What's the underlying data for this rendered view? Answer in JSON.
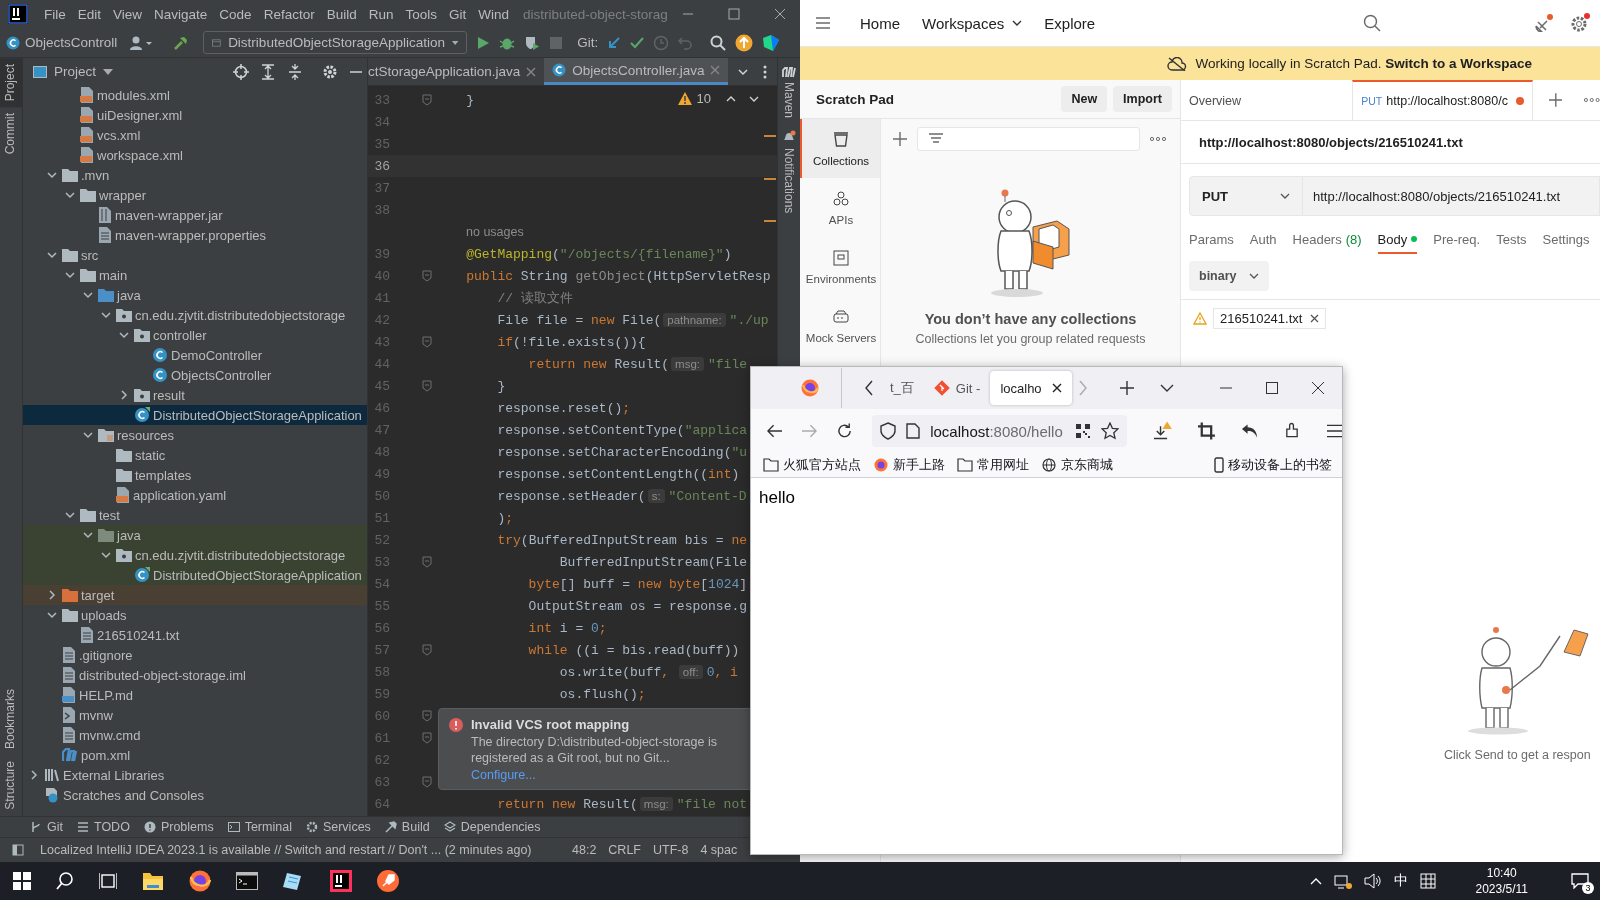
{
  "ide": {
    "menu": [
      "File",
      "Edit",
      "View",
      "Navigate",
      "Code",
      "Refactor",
      "Build",
      "Run",
      "Tools",
      "Git",
      "Wind"
    ],
    "title": "distributed-object-storag",
    "toolbar": {
      "file_label": "ObjectsControll",
      "run_config": "DistributedObjectStorageApplication",
      "vcs_label": "Git:"
    },
    "left_strip_top": [
      {
        "label": "Project",
        "selected": true
      },
      {
        "label": "Commit",
        "selected": false
      }
    ],
    "left_strip_bottom": [
      {
        "label": "Bookmarks",
        "selected": false
      },
      {
        "label": "Structure",
        "selected": false
      }
    ],
    "right_strip": [
      {
        "label": "Maven",
        "kind": "maven"
      },
      {
        "label": "Notifications",
        "kind": "bell"
      }
    ],
    "project_header": "Project",
    "tree": {
      "partial_top": [
        {
          "label": "modules.xml",
          "kind": "xml",
          "selected": false
        },
        {
          "label": "uiDesigner.xml",
          "kind": "xml",
          "selected": false
        },
        {
          "label": "vcs.xml",
          "kind": "xml",
          "selected": false
        },
        {
          "label": "workspace.xml",
          "kind": "xml",
          "selected": false
        }
      ],
      "items": [
        {
          "label": ".mvn",
          "kind": "folder",
          "expanded": true,
          "selected": false,
          "children": [
            {
              "label": "wrapper",
              "kind": "folder",
              "expanded": true,
              "selected": false,
              "children": [
                {
                  "label": "maven-wrapper.jar",
                  "kind": "jar",
                  "selected": false
                },
                {
                  "label": "maven-wrapper.properties",
                  "kind": "properties",
                  "selected": false
                }
              ]
            }
          ]
        },
        {
          "label": "src",
          "kind": "folder",
          "expanded": true,
          "selected": false,
          "children": [
            {
              "label": "main",
              "kind": "folder",
              "expanded": true,
              "selected": false,
              "children": [
                {
                  "label": "java",
                  "kind": "source-folder",
                  "expanded": true,
                  "selected": false,
                  "children": [
                    {
                      "label": "cn.edu.zjvtit.distributedobjectstorage",
                      "kind": "package",
                      "expanded": true,
                      "selected": false,
                      "children": [
                        {
                          "label": "controller",
                          "kind": "package",
                          "expanded": true,
                          "selected": false,
                          "children": [
                            {
                              "label": "DemoController",
                              "kind": "class",
                              "selected": false
                            },
                            {
                              "label": "ObjectsController",
                              "kind": "class",
                              "selected": false
                            }
                          ]
                        },
                        {
                          "label": "result",
                          "kind": "package",
                          "expanded": false,
                          "selected": false
                        },
                        {
                          "label": "DistributedObjectStorageApplication",
                          "kind": "spring-class",
                          "selected": true
                        }
                      ]
                    }
                  ]
                },
                {
                  "label": "resources",
                  "kind": "resources-folder",
                  "expanded": true,
                  "selected": false,
                  "children": [
                    {
                      "label": "static",
                      "kind": "folder",
                      "selected": false
                    },
                    {
                      "label": "templates",
                      "kind": "folder",
                      "selected": false
                    },
                    {
                      "label": "application.yaml",
                      "kind": "yaml",
                      "selected": false
                    }
                  ]
                }
              ]
            },
            {
              "label": "test",
              "kind": "folder",
              "expanded": true,
              "selected": false,
              "children": [
                {
                  "label": "java",
                  "kind": "test-folder",
                  "expanded": true,
                  "selected": false,
                  "test_scope": true,
                  "children": [
                    {
                      "label": "cn.edu.zjvtit.distributedobjectstorage",
                      "kind": "package",
                      "expanded": true,
                      "selected": false,
                      "test_scope": true,
                      "children": [
                        {
                          "label": "DistributedObjectStorageApplication",
                          "kind": "spring-class",
                          "selected": false,
                          "test_scope": true
                        }
                      ]
                    }
                  ]
                }
              ]
            }
          ]
        },
        {
          "label": "target",
          "kind": "excluded-folder",
          "expanded": false,
          "selected": false,
          "excluded": true
        },
        {
          "label": "uploads",
          "kind": "folder",
          "expanded": true,
          "selected": false,
          "children": [
            {
              "label": "216510241.txt",
              "kind": "text",
              "selected": false
            }
          ]
        },
        {
          "label": ".gitignore",
          "kind": "gitignore",
          "selected": false
        },
        {
          "label": "distributed-object-storage.iml",
          "kind": "iml",
          "selected": false
        },
        {
          "label": "HELP.md",
          "kind": "markdown",
          "selected": false
        },
        {
          "label": "mvnw",
          "kind": "script",
          "selected": false
        },
        {
          "label": "mvnw.cmd",
          "kind": "text",
          "selected": false
        },
        {
          "label": "pom.xml",
          "kind": "maven",
          "selected": false
        }
      ],
      "libraries": [
        {
          "label": "External Libraries",
          "kind": "libraries",
          "expanded": false,
          "selected": false
        },
        {
          "label": "Scratches and Consoles",
          "kind": "scratches",
          "selected": false
        }
      ]
    },
    "editor_tabs": [
      {
        "label": "ctStorageApplication.java",
        "selected": false
      },
      {
        "label": "ObjectsController.java",
        "selected": true
      }
    ],
    "warning_count": "10",
    "lines": [
      {
        "kind": "code",
        "number": "33",
        "current": false,
        "fold": true,
        "segments": [
          {
            "text": "    }",
            "kind": "plain"
          }
        ]
      },
      {
        "kind": "code",
        "number": "34",
        "current": false
      },
      {
        "kind": "code",
        "number": "35",
        "current": false
      },
      {
        "kind": "code",
        "number": "36",
        "current": true
      },
      {
        "kind": "code",
        "number": "37",
        "current": false
      },
      {
        "kind": "code",
        "number": "38",
        "current": false
      },
      {
        "kind": "inlay",
        "text": "no usages"
      },
      {
        "kind": "code",
        "number": "39",
        "current": false,
        "segments": [
          {
            "text": "    @GetMapping",
            "kind": "ann"
          },
          {
            "text": "(",
            "kind": "plain"
          },
          {
            "text": "\"/objects/{filename}\"",
            "kind": "str"
          },
          {
            "text": ")",
            "kind": "plain"
          }
        ]
      },
      {
        "kind": "code",
        "number": "40",
        "current": false,
        "fold": true,
        "segments": [
          {
            "text": "    public",
            "kind": "kw"
          },
          {
            "text": " String ",
            "kind": "plain"
          },
          {
            "text": "getObject",
            "kind": "fn"
          },
          {
            "text": "(HttpServletResp",
            "kind": "plain"
          }
        ]
      },
      {
        "kind": "code",
        "number": "41",
        "current": false,
        "segments": [
          {
            "text": "        // 读取文件",
            "kind": "cm"
          }
        ]
      },
      {
        "kind": "code",
        "number": "42",
        "current": false,
        "segments": [
          {
            "text": "        File file = ",
            "kind": "plain"
          },
          {
            "text": "new",
            "kind": "kw"
          },
          {
            "text": " File(",
            "kind": "plain"
          },
          {
            "text": "pathname:",
            "kind": "hint"
          },
          {
            "text": "\"./up",
            "kind": "str"
          }
        ]
      },
      {
        "kind": "code",
        "number": "43",
        "current": false,
        "fold": true,
        "segments": [
          {
            "text": "        if",
            "kind": "kw"
          },
          {
            "text": "(!file.exists()){",
            "kind": "plain"
          }
        ]
      },
      {
        "kind": "code",
        "number": "44",
        "current": false,
        "segments": [
          {
            "text": "            return new",
            "kind": "kw"
          },
          {
            "text": " Result(",
            "kind": "plain"
          },
          {
            "text": "msg:",
            "kind": "hint"
          },
          {
            "text": "\"file",
            "kind": "str"
          }
        ]
      },
      {
        "kind": "code",
        "number": "45",
        "current": false,
        "fold": true,
        "segments": [
          {
            "text": "        }",
            "kind": "plain"
          }
        ]
      },
      {
        "kind": "code",
        "number": "46",
        "current": false,
        "segments": [
          {
            "text": "        response.reset()",
            "kind": "plain"
          },
          {
            "text": ";",
            "kind": "kw"
          }
        ]
      },
      {
        "kind": "code",
        "number": "47",
        "current": false,
        "segments": [
          {
            "text": "        response.setContentType(",
            "kind": "plain"
          },
          {
            "text": "\"applica",
            "kind": "str"
          }
        ]
      },
      {
        "kind": "code",
        "number": "48",
        "current": false,
        "segments": [
          {
            "text": "        response.setCharacterEncoding(",
            "kind": "plain"
          },
          {
            "text": "\"u",
            "kind": "str"
          }
        ]
      },
      {
        "kind": "code",
        "number": "49",
        "current": false,
        "segments": [
          {
            "text": "        response.setContentLength((",
            "kind": "plain"
          },
          {
            "text": "int",
            "kind": "kw"
          },
          {
            "text": ")",
            "kind": "plain"
          }
        ]
      },
      {
        "kind": "code",
        "number": "50",
        "current": false,
        "segments": [
          {
            "text": "        response.setHeader(",
            "kind": "plain"
          },
          {
            "text": "s:",
            "kind": "hint"
          },
          {
            "text": "\"Content-D",
            "kind": "str"
          }
        ]
      },
      {
        "kind": "code",
        "number": "51",
        "current": false,
        "segments": [
          {
            "text": "        )",
            "kind": "plain"
          },
          {
            "text": ";",
            "kind": "kw"
          }
        ]
      },
      {
        "kind": "code",
        "number": "52",
        "current": false,
        "segments": [
          {
            "text": "        try",
            "kind": "kw"
          },
          {
            "text": "(BufferedInputStream bis = ",
            "kind": "plain"
          },
          {
            "text": "ne",
            "kind": "kw"
          }
        ]
      },
      {
        "kind": "code",
        "number": "53",
        "current": false,
        "fold": true,
        "segments": [
          {
            "text": "                BufferedInputStream(File",
            "kind": "plain"
          }
        ]
      },
      {
        "kind": "code",
        "number": "54",
        "current": false,
        "segments": [
          {
            "text": "            byte",
            "kind": "kw"
          },
          {
            "text": "[] buff = ",
            "kind": "plain"
          },
          {
            "text": "new byte",
            "kind": "kw"
          },
          {
            "text": "[",
            "kind": "plain"
          },
          {
            "text": "1024",
            "kind": "num"
          },
          {
            "text": "]",
            "kind": "plain"
          }
        ]
      },
      {
        "kind": "code",
        "number": "55",
        "current": false,
        "segments": [
          {
            "text": "            OutputStream os = response.g",
            "kind": "plain"
          }
        ]
      },
      {
        "kind": "code",
        "number": "56",
        "current": false,
        "segments": [
          {
            "text": "            int",
            "kind": "kw"
          },
          {
            "text": " i = ",
            "kind": "plain"
          },
          {
            "text": "0",
            "kind": "num"
          },
          {
            "text": ";",
            "kind": "kw"
          }
        ]
      },
      {
        "kind": "code",
        "number": "57",
        "current": false,
        "fold": true,
        "segments": [
          {
            "text": "            while",
            "kind": "kw"
          },
          {
            "text": " ((i = bis.read(buff))",
            "kind": "plain"
          }
        ]
      },
      {
        "kind": "code",
        "number": "58",
        "current": false,
        "segments": [
          {
            "text": "                os.write(buff",
            "kind": "plain"
          },
          {
            "text": ", ",
            "kind": "kw"
          },
          {
            "text": "off:",
            "kind": "hint"
          },
          {
            "text": "0",
            "kind": "num"
          },
          {
            "text": ", i",
            "kind": "kw"
          }
        ]
      },
      {
        "kind": "code",
        "number": "59",
        "current": false,
        "segments": [
          {
            "text": "                os.flush()",
            "kind": "plain"
          },
          {
            "text": ";",
            "kind": "kw"
          }
        ]
      },
      {
        "kind": "code",
        "number": "60",
        "current": false,
        "fold": true
      },
      {
        "kind": "code",
        "number": "61",
        "current": false,
        "fold": true
      },
      {
        "kind": "code",
        "number": "62",
        "current": false
      },
      {
        "kind": "code",
        "number": "63",
        "current": false,
        "fold": true
      },
      {
        "kind": "code",
        "number": "64",
        "current": false,
        "segments": [
          {
            "text": "        return new",
            "kind": "kw"
          },
          {
            "text": " Result(",
            "kind": "plain"
          },
          {
            "text": "msg:",
            "kind": "hint"
          },
          {
            "text": "\"file not",
            "kind": "str"
          }
        ]
      }
    ],
    "notification": {
      "title": "Invalid VCS root mapping",
      "body": "The directory D:\\distributed-object-storage is registered as a Git root, but no Git...",
      "link": "Configure..."
    },
    "tool_tabs": [
      {
        "label": "Git",
        "kind": "branch"
      },
      {
        "label": "TODO",
        "kind": "list"
      },
      {
        "label": "Problems",
        "kind": "alert"
      },
      {
        "label": "Terminal",
        "kind": "terminal"
      },
      {
        "label": "Services",
        "kind": "gear"
      },
      {
        "label": "Build",
        "kind": "hammer"
      },
      {
        "label": "Dependencies",
        "kind": "layers"
      }
    ],
    "status": {
      "message": "Localized IntelliJ IDEA 2023.1 is available // Switch and restart // Don't ... (2 minutes ago)",
      "position": "48:2",
      "line_ending": "CRLF",
      "encoding": "UTF-8",
      "indent": "4 spac"
    }
  },
  "postman": {
    "nav": [
      {
        "label": "Home",
        "kind": "link"
      },
      {
        "label": "Workspaces",
        "kind": "menu"
      },
      {
        "label": "Explore",
        "kind": "link"
      }
    ],
    "banner": "Working locally in Scratch Pad. **Switch to a Workspace**",
    "sidebar": {
      "title": "Scratch Pad",
      "buttons": [
        "New",
        "Import"
      ],
      "nav": [
        {
          "label": "Collections",
          "kind": "collections",
          "selected": true
        },
        {
          "label": "APIs",
          "kind": "apis",
          "selected": false
        },
        {
          "label": "Environments",
          "kind": "environments",
          "selected": false
        },
        {
          "label": "Mock Servers",
          "kind": "mock",
          "selected": false
        }
      ],
      "empty_title": "You don’t have any collections",
      "empty_text": "Collections let you group related requests"
    },
    "tabs": [
      {
        "kind": "overview",
        "label": "Overview",
        "selected": false
      },
      {
        "kind": "request",
        "method": "PUT",
        "label": "http://localhost:8080/c",
        "selected": true,
        "unsaved": true
      }
    ],
    "request": {
      "name": "http://localhost:8080/objects/216510241.txt",
      "method": "PUT",
      "url": "http://localhost:8080/objects/216510241.txt",
      "tabs": [
        {
          "label": "Params",
          "selected": false
        },
        {
          "label": "Auth",
          "selected": false
        },
        {
          "label": "Headers",
          "count": "(8)",
          "selected": false
        },
        {
          "label": "Body",
          "selected": true,
          "has_content": true
        },
        {
          "label": "Pre-req.",
          "selected": false
        },
        {
          "label": "Tests",
          "selected": false
        },
        {
          "label": "Settings",
          "selected": false
        }
      ],
      "body_mode": "binary",
      "file": "216510241.txt"
    },
    "response_hint": "Click Send to get a respon"
  },
  "browser": {
    "tabs": [
      {
        "label": "t_百",
        "kind": "plain",
        "selected": false
      },
      {
        "label": "Git -",
        "kind": "git",
        "selected": false
      },
      {
        "label": "localho",
        "kind": "plain",
        "selected": true
      }
    ],
    "url_host": "localhost",
    "url_rest": ":8080/hello",
    "bookmarks": [
      {
        "label": "火狐官方站点",
        "kind": "folder"
      },
      {
        "label": "新手上路",
        "kind": "firefox"
      },
      {
        "label": "常用网址",
        "kind": "folder"
      },
      {
        "label": "京东商城",
        "kind": "globe"
      }
    ],
    "mobile_bookmarks": "移动设备上的书签",
    "page_text": "hello"
  },
  "taskbar": {
    "apps": [
      {
        "kind": "explorer"
      },
      {
        "kind": "firefox"
      },
      {
        "kind": "terminal"
      },
      {
        "kind": "notepad"
      },
      {
        "kind": "intellij"
      },
      {
        "kind": "postman"
      }
    ],
    "ime": "中",
    "time": "10:40",
    "date": "2023/5/11",
    "notification_count": "3"
  }
}
